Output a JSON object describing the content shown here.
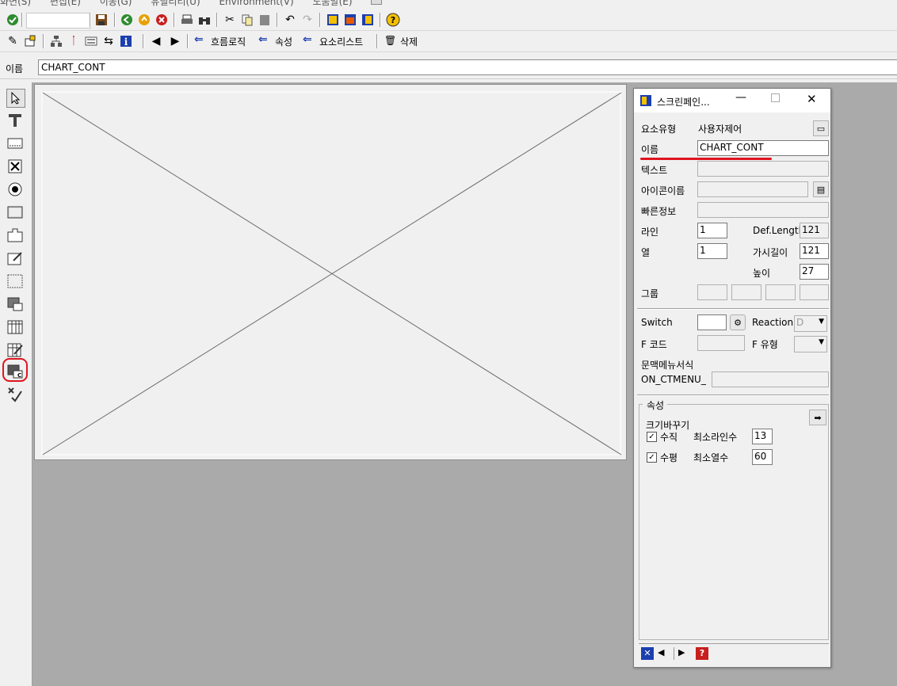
{
  "menu": [
    "화면(S)",
    "편집(E)",
    "이동(G)",
    "유틸리티(U)",
    "Environment(V)",
    "도움말(E)"
  ],
  "toolbar2": {
    "flow_logic": "흐름로직",
    "attributes": "속성",
    "element_list": "요소리스트",
    "delete": "삭제"
  },
  "name_row": {
    "label": "이름",
    "value": "CHART_CONT"
  },
  "props": {
    "title": "스크린페인...",
    "element_type_label": "요소유형",
    "element_type_value": "사용자제어",
    "name_label": "이름",
    "name_value": "CHART_CONT",
    "text_label": "텍스트",
    "icon_name_label": "아이콘이름",
    "quickinfo_label": "빠른정보",
    "line_label": "라인",
    "line_value": "1",
    "column_label": "열",
    "column_value": "1",
    "def_length_label": "Def.Lengtl",
    "def_length_value": "121",
    "vis_length_label": "가시길이",
    "vis_length_value": "121",
    "height_label": "높이",
    "height_value": "27",
    "group_label": "그룹",
    "switch_label": "Switch",
    "reaction_label": "Reaction",
    "reaction_value": "D",
    "fcode_label": "F 코드",
    "ftype_label": "F 유형",
    "ctxmenu_label": "문맥메뉴서식",
    "ctxmenu_prefix": "ON_CTMENU_",
    "attr_group_label": "속성",
    "resize_label": "크기바꾸기",
    "vertical_label": "수직",
    "min_lines_label": "최소라인수",
    "min_lines_value": "13",
    "horizontal_label": "수평",
    "min_cols_label": "최소열수",
    "min_cols_value": "60"
  },
  "colors": {
    "highlight_red": "#e0141e",
    "workspace_gray": "#aaaaaa",
    "arrow_blue": "#1c3fae"
  }
}
